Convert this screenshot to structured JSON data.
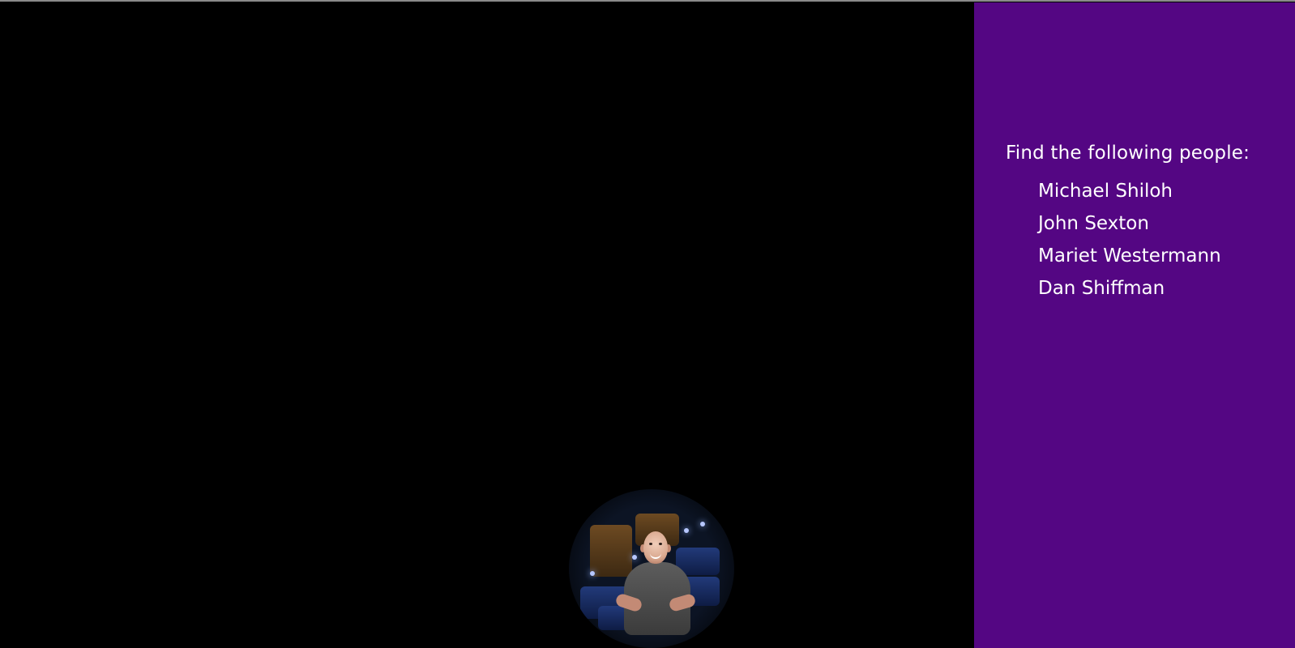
{
  "game": {
    "panel": {
      "title": "Find the following people:",
      "people": [
        "Michael Shiloh",
        "John Sexton",
        "Mariet Westermann",
        "Dan Shiffman"
      ]
    },
    "colors": {
      "scene_background": "#000000",
      "panel_background": "#540683",
      "panel_text": "#FFFFFF"
    },
    "icons": {
      "spotlight": "circular-reveal-photo",
      "person": "man-smiling"
    }
  }
}
